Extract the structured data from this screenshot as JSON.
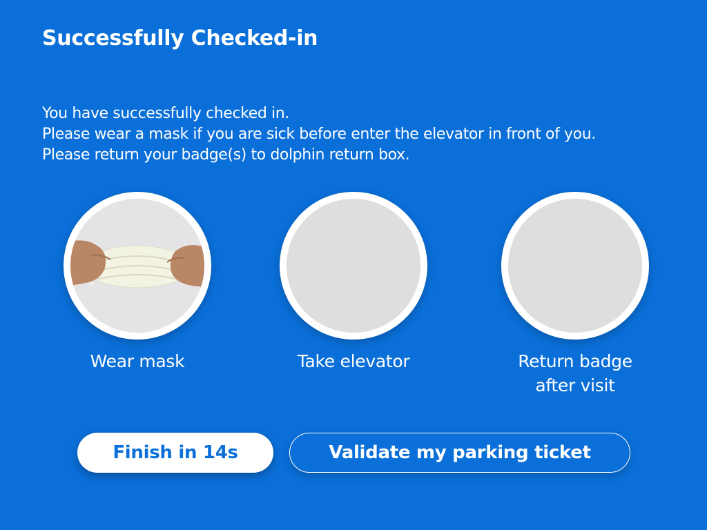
{
  "page": {
    "title": "Successfully Checked-in",
    "message_lines": [
      "You have successfully checked in.",
      "Please wear a mask if you are sick before enter the elevator in front of you.",
      "Please return your badge(s) to dolphin return box."
    ]
  },
  "steps": [
    {
      "label": "Wear mask",
      "icon": "mask-photo"
    },
    {
      "label": "Take elevator",
      "icon": "elevator-image-placeholder"
    },
    {
      "label_lines": [
        "Return badge",
        "after visit"
      ],
      "icon": "badge-image-placeholder"
    }
  ],
  "buttons": {
    "finish_label": "Finish in 14s",
    "parking_label": "Validate my parking ticket"
  },
  "colors": {
    "background": "#0a6fd8",
    "primary_button_bg": "#ffffff",
    "primary_button_text": "#0a6fd8",
    "placeholder": "#dedede"
  }
}
